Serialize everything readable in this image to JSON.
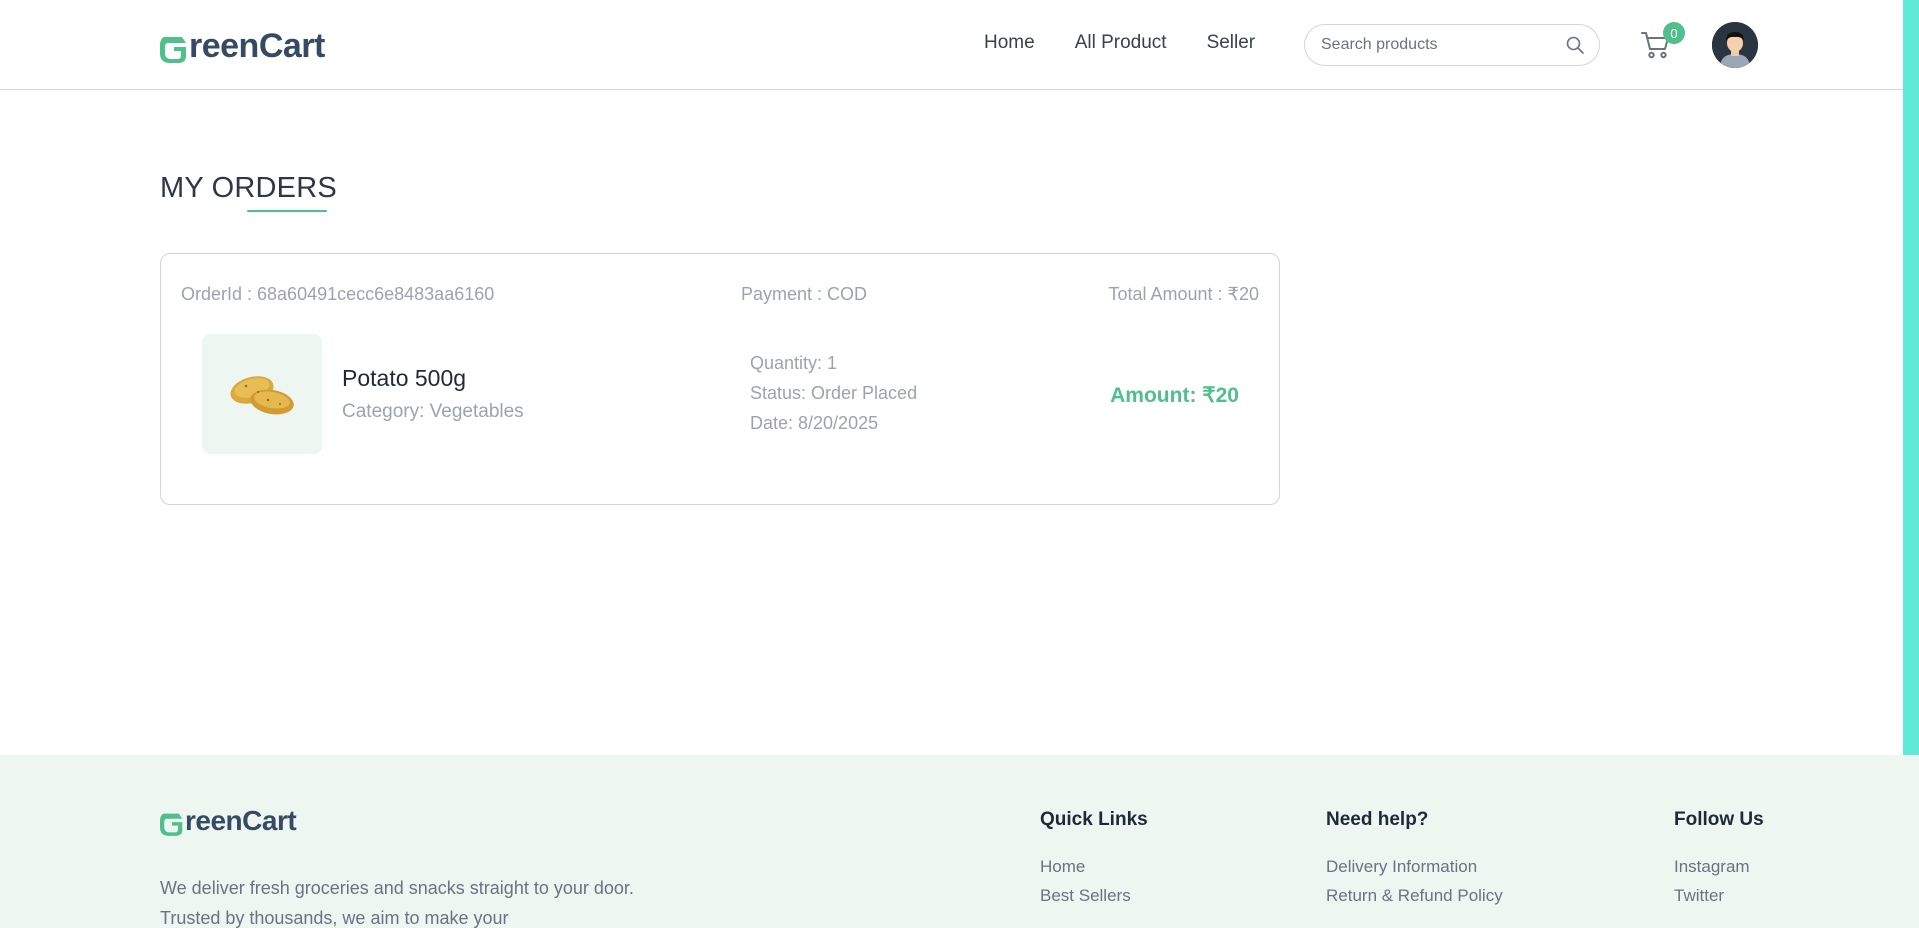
{
  "brand": {
    "logo_text": "reenCart",
    "accent": "#4fbf8b",
    "text_color": "#364a63"
  },
  "nav": {
    "links": [
      "Home",
      "All Product",
      "Seller"
    ],
    "search_placeholder": "Search products",
    "cart_count": "0"
  },
  "main": {
    "title": "MY ORDERS",
    "order": {
      "order_id": "OrderId : 68a60491cecc6e8483aa6160",
      "payment": "Payment : COD",
      "total": "Total Amount : ₹20",
      "item": {
        "name": "Potato 500g",
        "category": "Category: Vegetables",
        "quantity": "Quantity: 1",
        "status": "Status: Order Placed",
        "date": "Date: 8/20/2025",
        "amount": "Amount: ₹20"
      }
    }
  },
  "footer": {
    "logo_text": "reenCart",
    "description": "We deliver fresh groceries and snacks straight to your door. Trusted by thousands, we aim to make your",
    "columns": [
      {
        "title": "Quick Links",
        "links": [
          "Home",
          "Best Sellers"
        ]
      },
      {
        "title": "Need help?",
        "links": [
          "Delivery Information",
          "Return & Refund Policy"
        ]
      },
      {
        "title": "Follow Us",
        "links": [
          "Instagram",
          "Twitter"
        ]
      }
    ]
  }
}
